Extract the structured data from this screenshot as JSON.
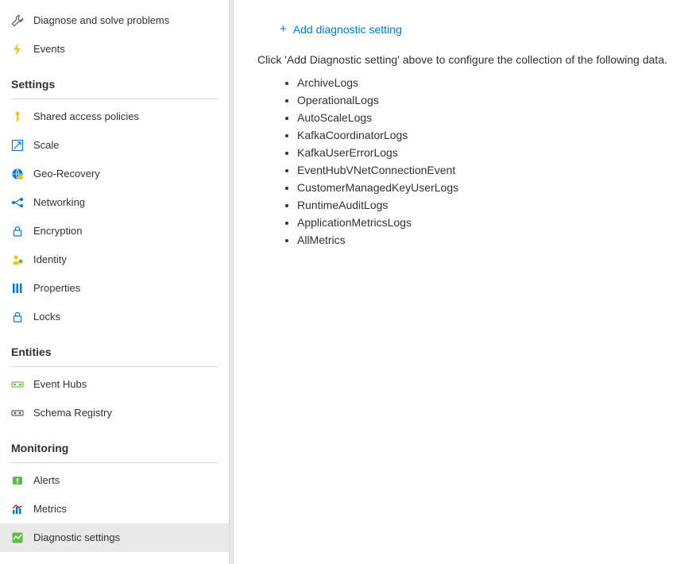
{
  "sidebar": {
    "top_items": [
      {
        "key": "diagnose",
        "label": "Diagnose and solve problems"
      },
      {
        "key": "events",
        "label": "Events"
      }
    ],
    "sections": [
      {
        "header": "Settings",
        "items": [
          {
            "key": "shared-access-policies",
            "label": "Shared access policies"
          },
          {
            "key": "scale",
            "label": "Scale"
          },
          {
            "key": "geo-recovery",
            "label": "Geo-Recovery"
          },
          {
            "key": "networking",
            "label": "Networking"
          },
          {
            "key": "encryption",
            "label": "Encryption"
          },
          {
            "key": "identity",
            "label": "Identity"
          },
          {
            "key": "properties",
            "label": "Properties"
          },
          {
            "key": "locks",
            "label": "Locks"
          }
        ]
      },
      {
        "header": "Entities",
        "items": [
          {
            "key": "event-hubs",
            "label": "Event Hubs"
          },
          {
            "key": "schema-registry",
            "label": "Schema Registry"
          }
        ]
      },
      {
        "header": "Monitoring",
        "items": [
          {
            "key": "alerts",
            "label": "Alerts"
          },
          {
            "key": "metrics",
            "label": "Metrics"
          },
          {
            "key": "diagnostic-settings",
            "label": "Diagnostic settings",
            "selected": true
          }
        ]
      }
    ]
  },
  "main": {
    "add_button_label": "Add diagnostic setting",
    "instruction_text": "Click 'Add Diagnostic setting' above to configure the collection of the following data.",
    "data_types": [
      "ArchiveLogs",
      "OperationalLogs",
      "AutoScaleLogs",
      "KafkaCoordinatorLogs",
      "KafkaUserErrorLogs",
      "EventHubVNetConnectionEvent",
      "CustomerManagedKeyUserLogs",
      "RuntimeAuditLogs",
      "ApplicationMetricsLogs",
      "AllMetrics"
    ]
  }
}
